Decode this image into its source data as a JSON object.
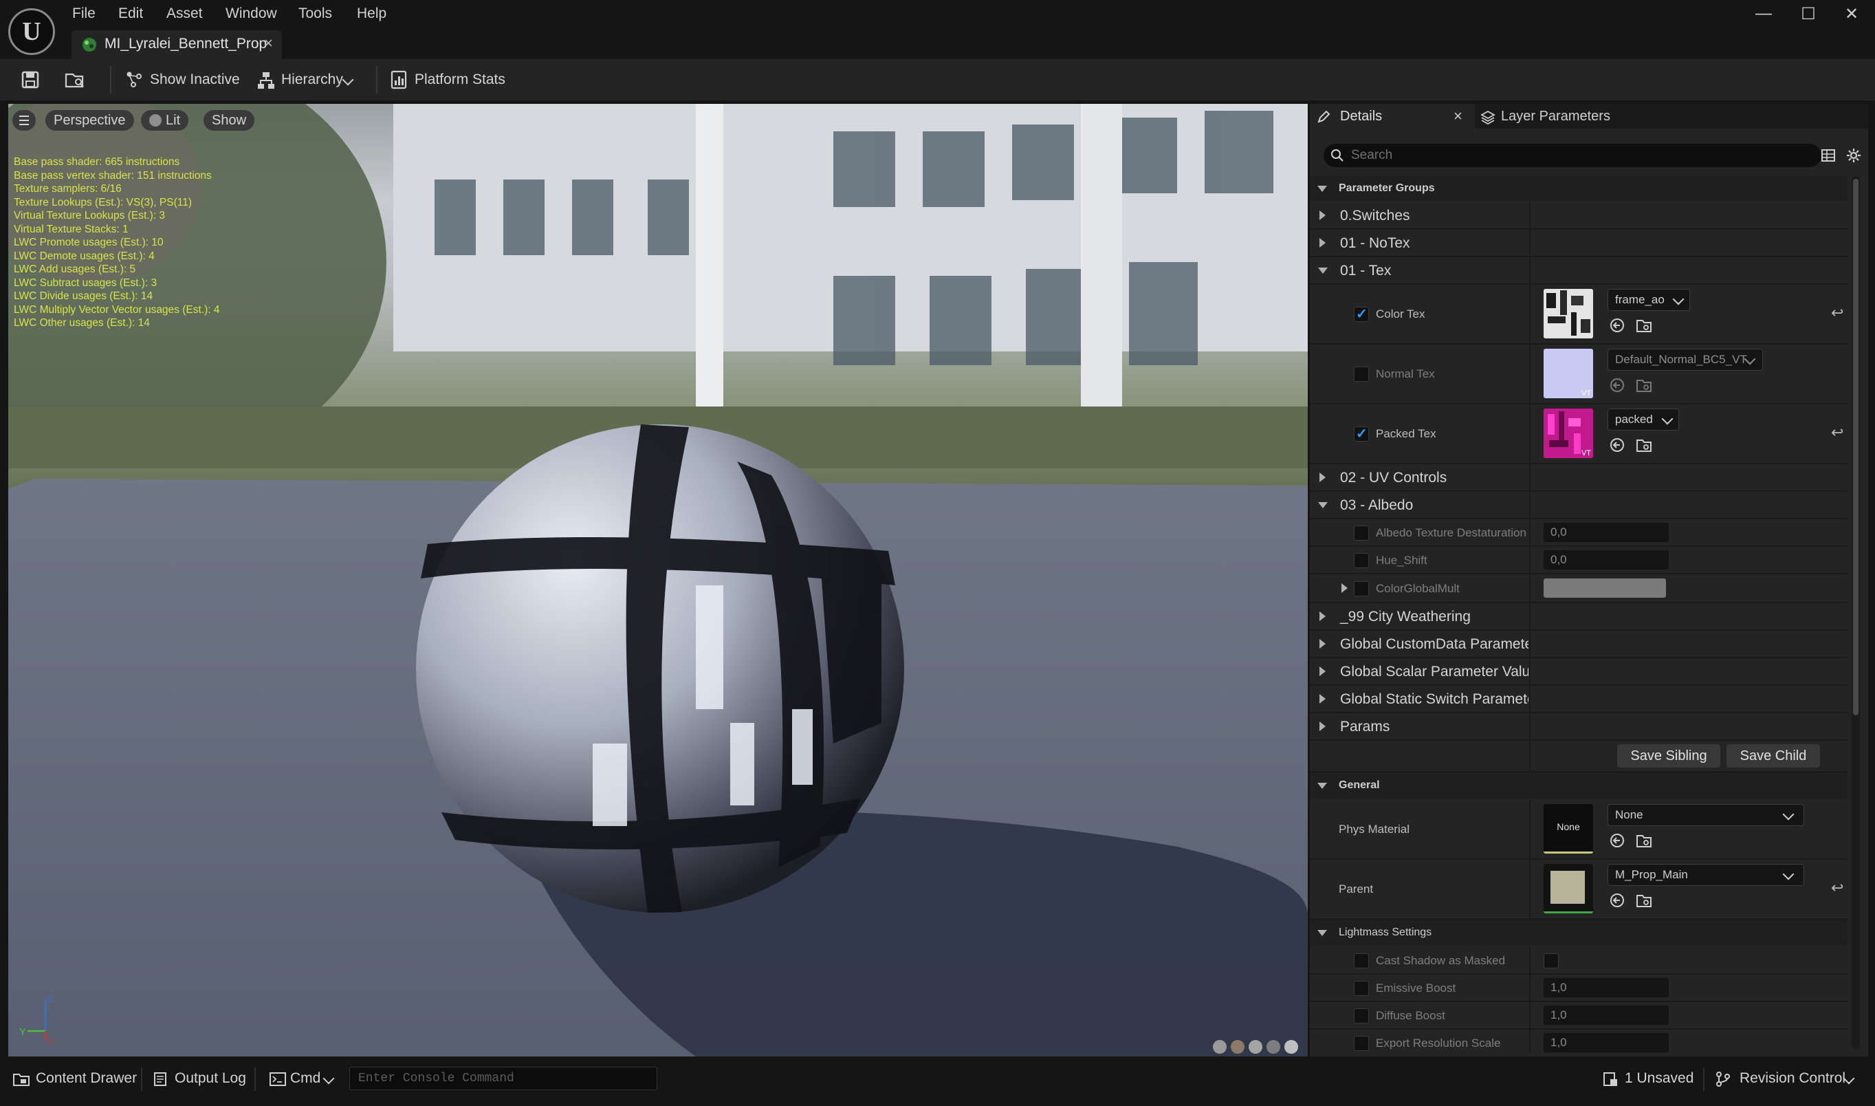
{
  "menu": [
    "File",
    "Edit",
    "Asset",
    "Window",
    "Tools",
    "Help"
  ],
  "document_tab": "MI_Lyralei_Bennett_Prop",
  "window_controls": {
    "minimize": "—",
    "maximize": "☐",
    "close": "✕"
  },
  "toolbar": {
    "show_inactive": "Show Inactive",
    "hierarchy": "Hierarchy",
    "platform_stats": "Platform Stats"
  },
  "viewport": {
    "view_mode": "Perspective",
    "lighting": "Lit",
    "show": "Show",
    "stats": [
      "Base pass shader: 665 instructions",
      "Base pass vertex shader: 151 instructions",
      "Texture samplers: 6/16",
      "Texture Lookups (Est.): VS(3), PS(11)",
      "Virtual Texture Lookups (Est.): 3",
      "Virtual Texture Stacks: 1",
      "LWC Promote usages (Est.): 10",
      "LWC Demote usages (Est.): 4",
      "LWC Add usages (Est.): 5",
      "LWC Subtract usages (Est.): 3",
      "LWC Divide usages (Est.): 14",
      "LWC Multiply Vector Vector usages (Est.): 4",
      "LWC Other usages (Est.): 14"
    ],
    "axis": {
      "z": "Z",
      "y": "Y",
      "x": "X"
    }
  },
  "details": {
    "tab_details": "Details",
    "tab_close": "×",
    "tab_layer_parameters": "Layer Parameters",
    "search_placeholder": "Search",
    "parameter_groups_header": "Parameter Groups",
    "groups_top": [
      "0.Switches",
      "01 - NoTex",
      "01 - Tex"
    ],
    "textures": [
      {
        "label": "Color Tex",
        "checked": true,
        "value": "frame_ao"
      },
      {
        "label": "Normal Tex",
        "checked": false,
        "value": "Default_Normal_BC5_VT"
      },
      {
        "label": "Packed Tex",
        "checked": true,
        "value": "packed"
      }
    ],
    "vt_badge": "VT",
    "groups_mid": [
      "02 - UV Controls",
      "03 - Albedo"
    ],
    "albedo_params": [
      {
        "label": "Albedo Texture Destaturation",
        "value": "0,0"
      },
      {
        "label": "Hue_Shift",
        "value": "0,0"
      }
    ],
    "color_global_mult": "ColorGlobalMult",
    "groups_bottom": [
      "_99 City Weathering",
      "Global CustomData Parameter",
      "Global Scalar Parameter Values",
      "Global Static Switch Parameter",
      "Params"
    ],
    "save_sibling": "Save Sibling",
    "save_child": "Save Child",
    "general_header": "General",
    "phys_material_label": "Phys Material",
    "phys_material_thumb": "None",
    "phys_material_value": "None",
    "parent_label": "Parent",
    "parent_value": "M_Prop_Main",
    "lightmass_header": "Lightmass Settings",
    "lightmass": [
      {
        "label": "Cast Shadow as Masked",
        "value": ""
      },
      {
        "label": "Emissive Boost",
        "value": "1,0"
      },
      {
        "label": "Diffuse Boost",
        "value": "1,0"
      },
      {
        "label": "Export Resolution Scale",
        "value": "1,0"
      }
    ]
  },
  "statusbar": {
    "content_drawer": "Content Drawer",
    "output_log": "Output Log",
    "cmd": "Cmd",
    "console_placeholder": "Enter Console Command",
    "unsaved": "1 Unsaved",
    "revision_control": "Revision Control"
  },
  "colors": {
    "accent": "#2a9fff",
    "stats_text": "#d8e34a",
    "panel_bg": "#242424"
  }
}
